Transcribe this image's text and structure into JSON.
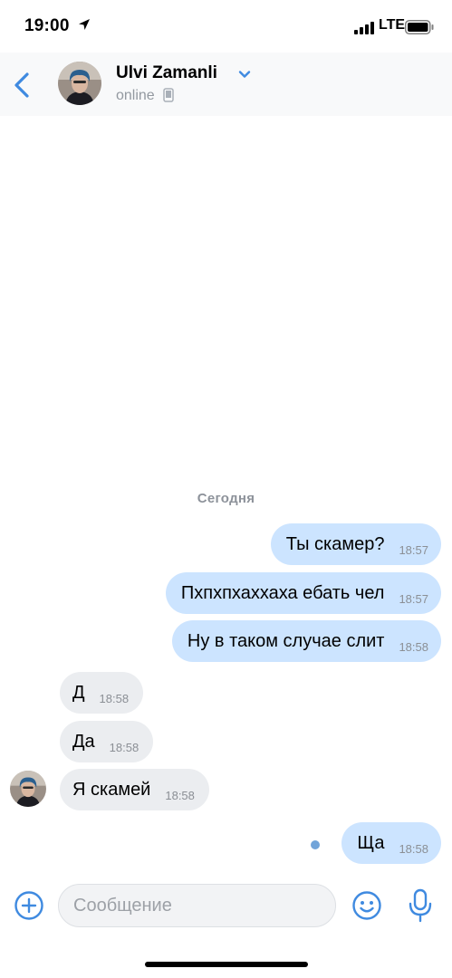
{
  "status_bar": {
    "time": "19:00",
    "network": "LTE"
  },
  "header": {
    "name": "Ulvi Zamanli",
    "status": "online"
  },
  "date_separator": "Сегодня",
  "messages": [
    {
      "direction": "out",
      "text": "Ты скамер?",
      "time": "18:57"
    },
    {
      "direction": "out",
      "text": "Пхпхпхаххаха ебать чел",
      "time": "18:57"
    },
    {
      "direction": "out",
      "text": "Ну в таком случае слит",
      "time": "18:58"
    },
    {
      "direction": "in",
      "text": "Д",
      "time": "18:58"
    },
    {
      "direction": "in",
      "text": "Да",
      "time": "18:58"
    },
    {
      "direction": "in",
      "text": "Я скамей",
      "time": "18:58"
    },
    {
      "direction": "out",
      "text": "Ща",
      "time": "18:58"
    }
  ],
  "composer": {
    "placeholder": "Сообщение",
    "value": ""
  },
  "icons": {
    "back": "chevron-left-icon",
    "expand": "chevron-down-icon",
    "device": "phone-icon",
    "attach": "plus-circle-icon",
    "emoji": "smile-icon",
    "mic": "microphone-icon"
  },
  "colors": {
    "accent": "#3f8ae0",
    "outgoing_bubble": "#cce4ff",
    "incoming_bubble": "#ebedf0",
    "header_bg": "#f8f9fa",
    "secondary_text": "#8b8f95"
  }
}
